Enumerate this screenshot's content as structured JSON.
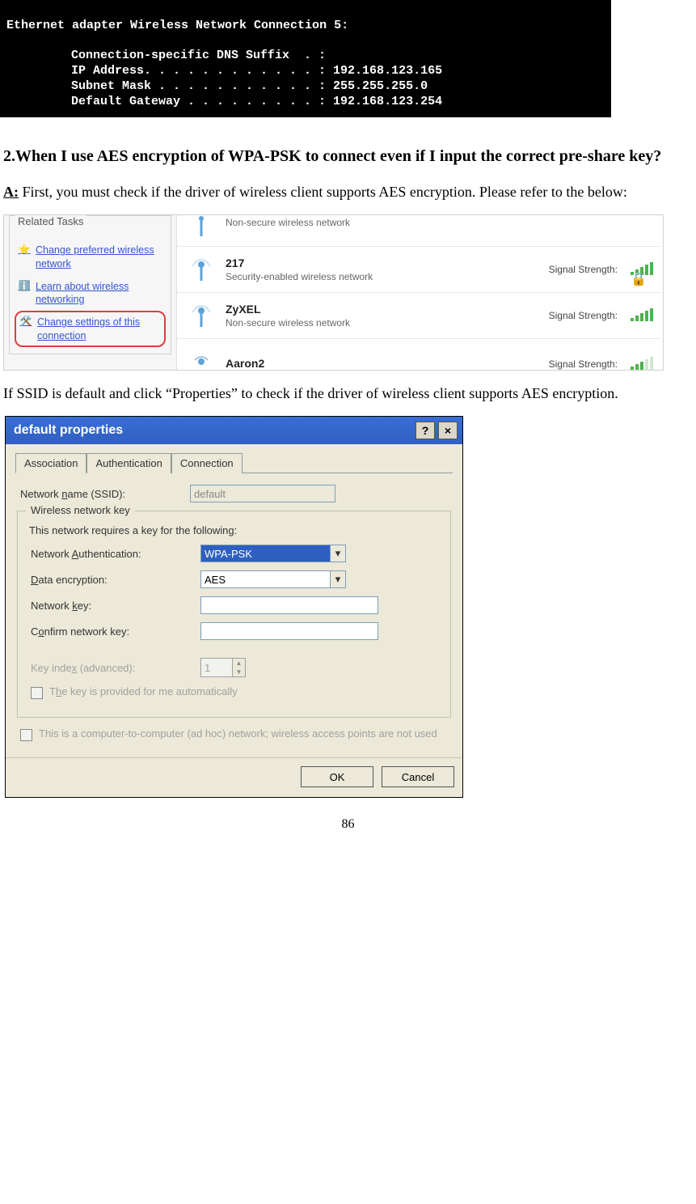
{
  "console": {
    "header": "Ethernet adapter Wireless Network Connection 5:",
    "lines": [
      "Connection-specific DNS Suffix  . :",
      "IP Address. . . . . . . . . . . . : 192.168.123.165",
      "Subnet Mask . . . . . . . . . . . : 255.255.255.0",
      "Default Gateway . . . . . . . . . : 192.168.123.254"
    ]
  },
  "doc": {
    "question": "2.When I use AES encryption of WPA-PSK to connect even if I input the correct pre-share key?",
    "answer_prefix": "A:",
    "answer_body": " First, you must check if the driver of wireless client supports AES encryption. Please refer to the below:",
    "mid_paragraph": "If SSID is default and click “Properties” to check if the driver of wireless client supports AES encryption.",
    "page_number": "86"
  },
  "wifi": {
    "sidebar_title": "Related Tasks",
    "tasks": [
      {
        "label": "Change preferred wireless network",
        "icon": "star"
      },
      {
        "label": "Learn about wireless networking",
        "icon": "info"
      },
      {
        "label": "Change settings of this connection",
        "icon": "tools",
        "highlight": true
      }
    ],
    "networks": [
      {
        "name": "",
        "sub": "Non-secure wireless network",
        "strength": "",
        "bars": "none",
        "half_top": true
      },
      {
        "name": "217",
        "sub": "Security-enabled wireless network",
        "strength": "Signal Strength:",
        "bars": "full",
        "lock": true
      },
      {
        "name": "ZyXEL",
        "sub": "Non-secure wireless network",
        "strength": "Signal Strength:",
        "bars": "full"
      },
      {
        "name": "Aaron2",
        "sub": "",
        "strength": "Signal Strength:",
        "bars": "dim",
        "half_bottom": true
      }
    ]
  },
  "dialog": {
    "title": "default properties",
    "tabs": [
      "Association",
      "Authentication",
      "Connection"
    ],
    "active_tab": 0,
    "ssid_label": "Network name (SSID):",
    "ssid_value": "default",
    "group_title": "Wireless network key",
    "group_desc": "This network requires a key for the following:",
    "auth_label": "Network Authentication:",
    "auth_value": "WPA-PSK",
    "enc_label": "Data encryption:",
    "enc_value": "AES",
    "netkey_label": "Network key:",
    "netkey_value": "",
    "confirm_label": "Confirm network key:",
    "confirm_value": "",
    "keyindex_label": "Key index (advanced):",
    "keyindex_value": "1",
    "auto_key_label": "The key is provided for me automatically",
    "adhoc_label": "This is a computer-to-computer (ad hoc) network; wireless access points are not used",
    "ok": "OK",
    "cancel": "Cancel"
  }
}
